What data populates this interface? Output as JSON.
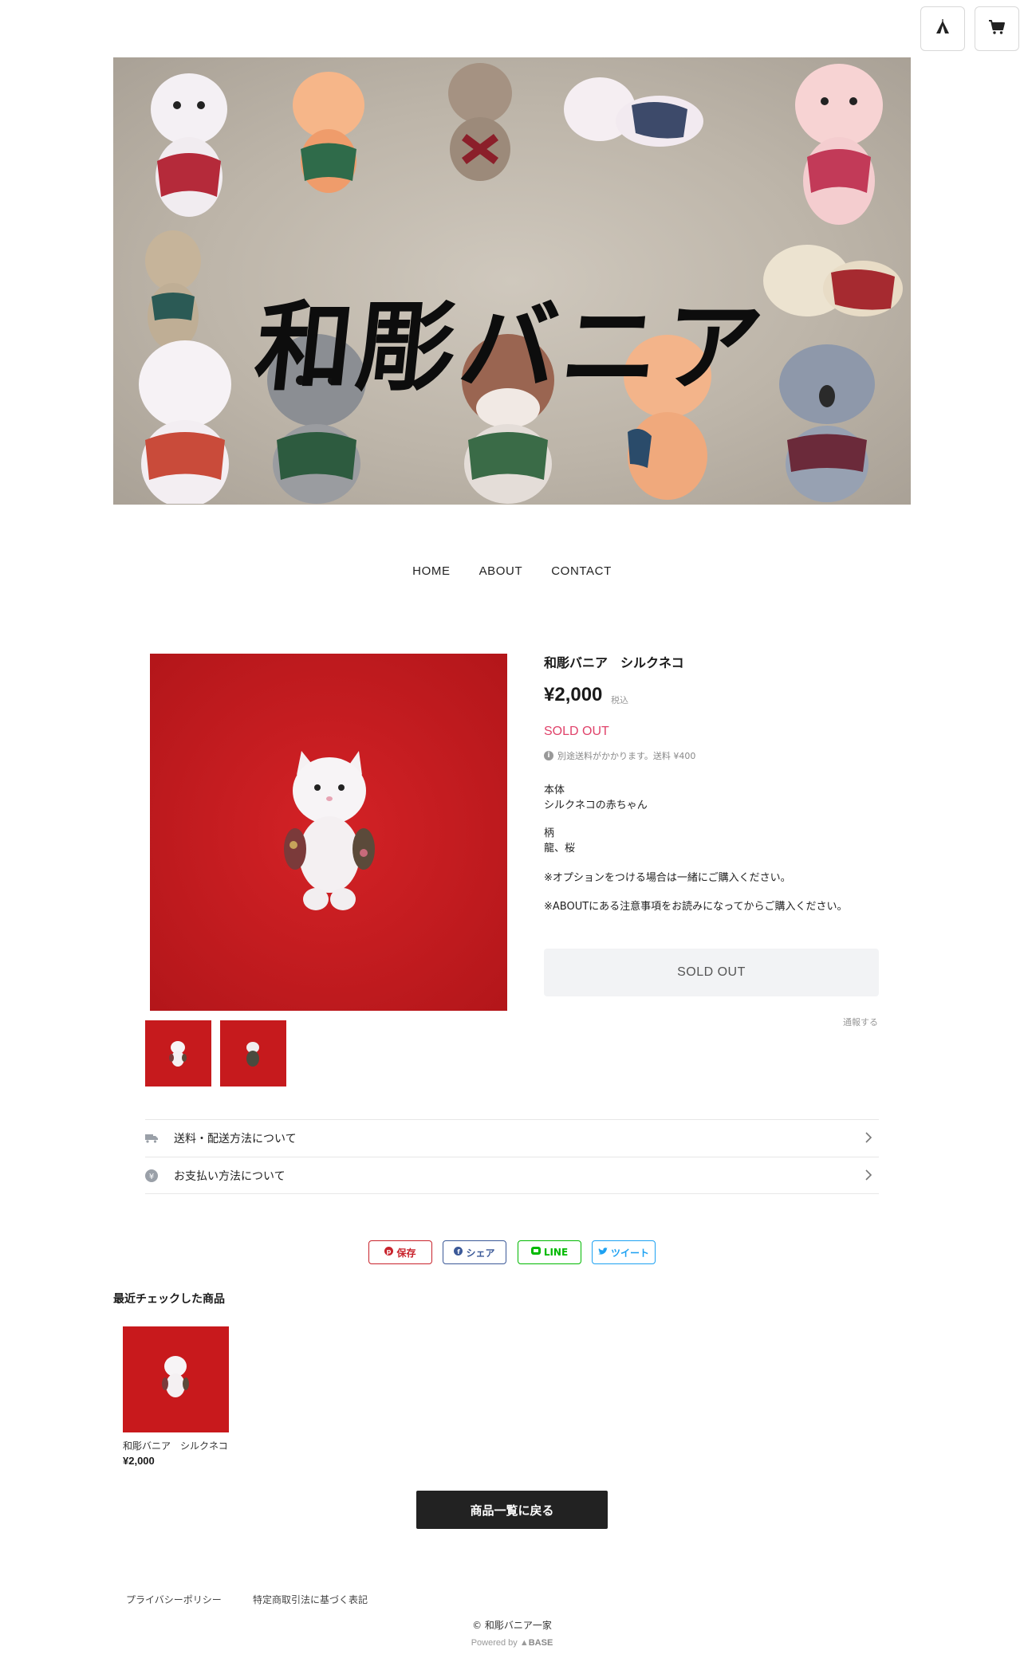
{
  "header": {
    "icons": [
      "shop-tent-icon",
      "cart-icon"
    ]
  },
  "hero": {
    "title": "和彫バニア"
  },
  "nav": {
    "items": [
      "HOME",
      "ABOUT",
      "CONTACT"
    ]
  },
  "product": {
    "title": "和彫バニア　シルクネコ",
    "price": "¥2,000",
    "tax": "税込",
    "status": "SOLD OUT",
    "shipping_note": "別途送料がかかります。送料 ¥400",
    "description": {
      "body_label": "本体",
      "body_value": "シルクネコの赤ちゃん",
      "pattern_label": "柄",
      "pattern_value": "龍、桜",
      "note1": "※オプションをつける場合は一緒にご購入ください。",
      "note2": "※ABOUTにある注意事項をお読みになってからご購入ください。"
    },
    "button_label": "SOLD OUT",
    "report_label": "通報する"
  },
  "accordion": {
    "shipping": "送料・配送方法について",
    "payment": "お支払い方法について"
  },
  "share": {
    "pinterest": "保存",
    "facebook": "シェア",
    "line": "LINE",
    "twitter": "ツイート"
  },
  "recent": {
    "title": "最近チェックした商品",
    "items": [
      {
        "name": "和彫バニア　シルクネコ",
        "price": "¥2,000"
      }
    ]
  },
  "back_button": "商品一覧に戻る",
  "footer": {
    "privacy": "プライバシーポリシー",
    "law": "特定商取引法に基づく表記",
    "copyright": "© 和彫バニア一家",
    "powered_prefix": "Powered by",
    "powered_brand": "BASE"
  },
  "colors": {
    "sold_out": "#e0426a",
    "photo_bg": "#c8191c",
    "pinterest": "#c8232c",
    "facebook": "#3b5998",
    "line": "#00b900",
    "twitter": "#1da1f2"
  }
}
